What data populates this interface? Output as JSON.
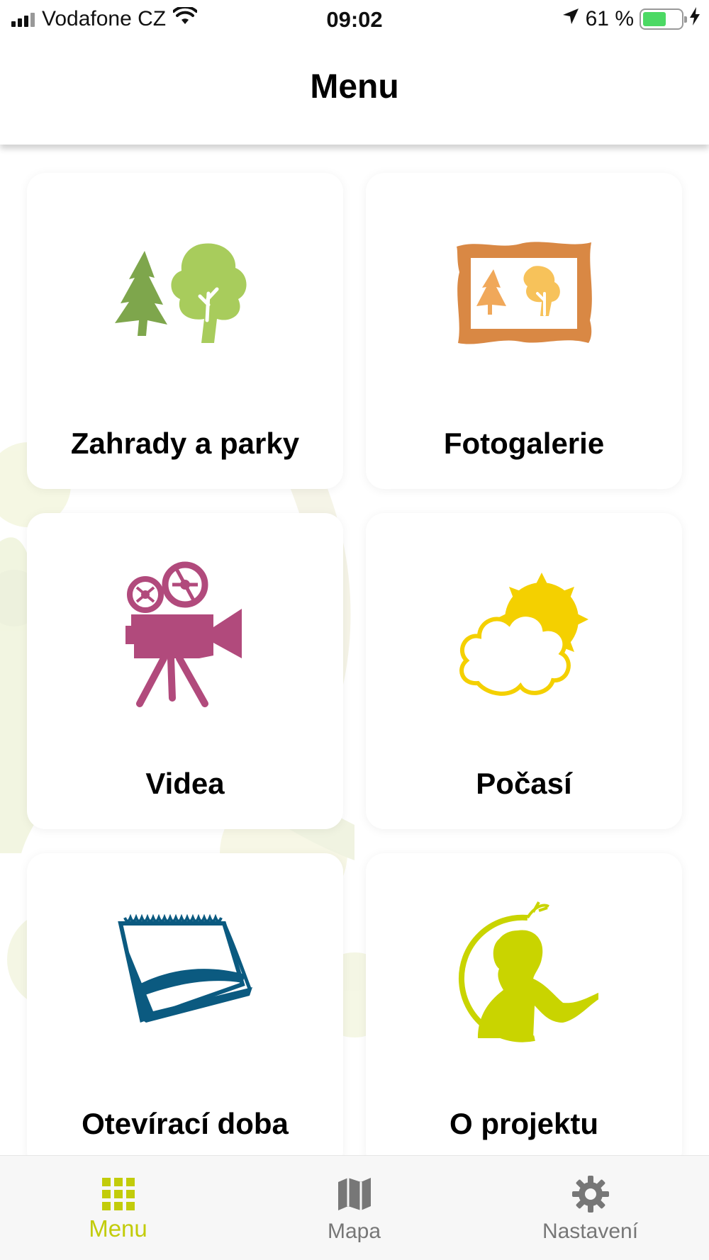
{
  "status_bar": {
    "carrier": "Vodafone CZ",
    "time": "09:02",
    "battery_percent": "61 %",
    "battery_level": 0.61
  },
  "header": {
    "title": "Menu"
  },
  "menu": {
    "items": [
      {
        "label": "Zahrady a parky",
        "icon": "trees-icon"
      },
      {
        "label": "Fotogalerie",
        "icon": "picture-frame-icon"
      },
      {
        "label": "Videa",
        "icon": "film-camera-icon"
      },
      {
        "label": "Počasí",
        "icon": "weather-icon"
      },
      {
        "label": "Otevírací doba",
        "icon": "calendar-icon"
      },
      {
        "label": "O projektu",
        "icon": "project-logo-icon"
      }
    ]
  },
  "tab_bar": {
    "tabs": [
      {
        "label": "Menu",
        "icon": "grid-icon",
        "active": true
      },
      {
        "label": "Mapa",
        "icon": "map-icon",
        "active": false
      },
      {
        "label": "Nastavení",
        "icon": "gear-icon",
        "active": false
      }
    ]
  },
  "colors": {
    "accent": "#c2cc0a",
    "inactive_tab": "#777777",
    "trees_dark": "#7ea64c",
    "trees_light": "#a8cc5c",
    "frame": "#d98844",
    "camera": "#b14a7c",
    "sun": "#f4d000",
    "calendar": "#0b5a80",
    "project": "#c9d400"
  }
}
